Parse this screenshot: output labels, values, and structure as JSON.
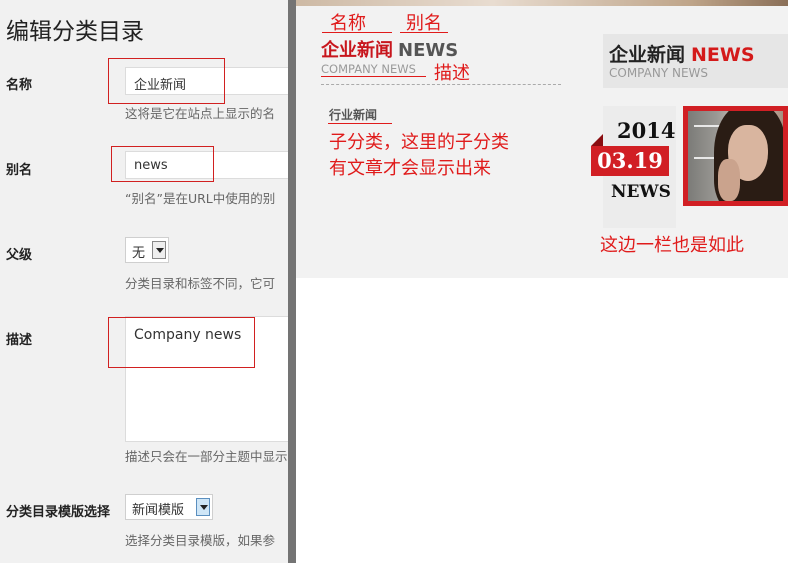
{
  "admin": {
    "page_title": "编辑分类目录",
    "fields": {
      "name": {
        "label": "名称",
        "value": "企业新闻",
        "help": "这将是它在站点上显示的名"
      },
      "slug": {
        "label": "别名",
        "value": "news",
        "help": "“别名”是在URL中使用的别"
      },
      "parent": {
        "label": "父级",
        "value": "无",
        "help": "分类目录和标签不同，它可"
      },
      "description": {
        "label": "描述",
        "value": "Company news",
        "help": "描述只会在一部分主题中显示"
      },
      "template": {
        "label": "分类目录模版选择",
        "value": "新闻模版",
        "help": "选择分类目录模版，如果参"
      }
    }
  },
  "preview": {
    "category_name_cn": "企业新闻",
    "category_name_en": "NEWS",
    "category_subtitle": "COMPANY NEWS",
    "subcategory": "行业新闻",
    "widget": {
      "title_cn": "企业新闻",
      "title_en": "NEWS",
      "subtitle": "COMPANY NEWS",
      "year": "2014",
      "date": "03.19",
      "news_word": "NEWS"
    }
  },
  "annotations": {
    "name": "名称",
    "slug": "别名",
    "description": "描述",
    "subcategory_note_line1": "子分类，这里的子分类",
    "subcategory_note_line2": "有文章才会显示出来",
    "sidebar_note": "这边一栏也是如此"
  },
  "colors": {
    "accent_red": "#d11f24",
    "annotation_red": "#e01b1b",
    "divider_gray": "#747474"
  }
}
